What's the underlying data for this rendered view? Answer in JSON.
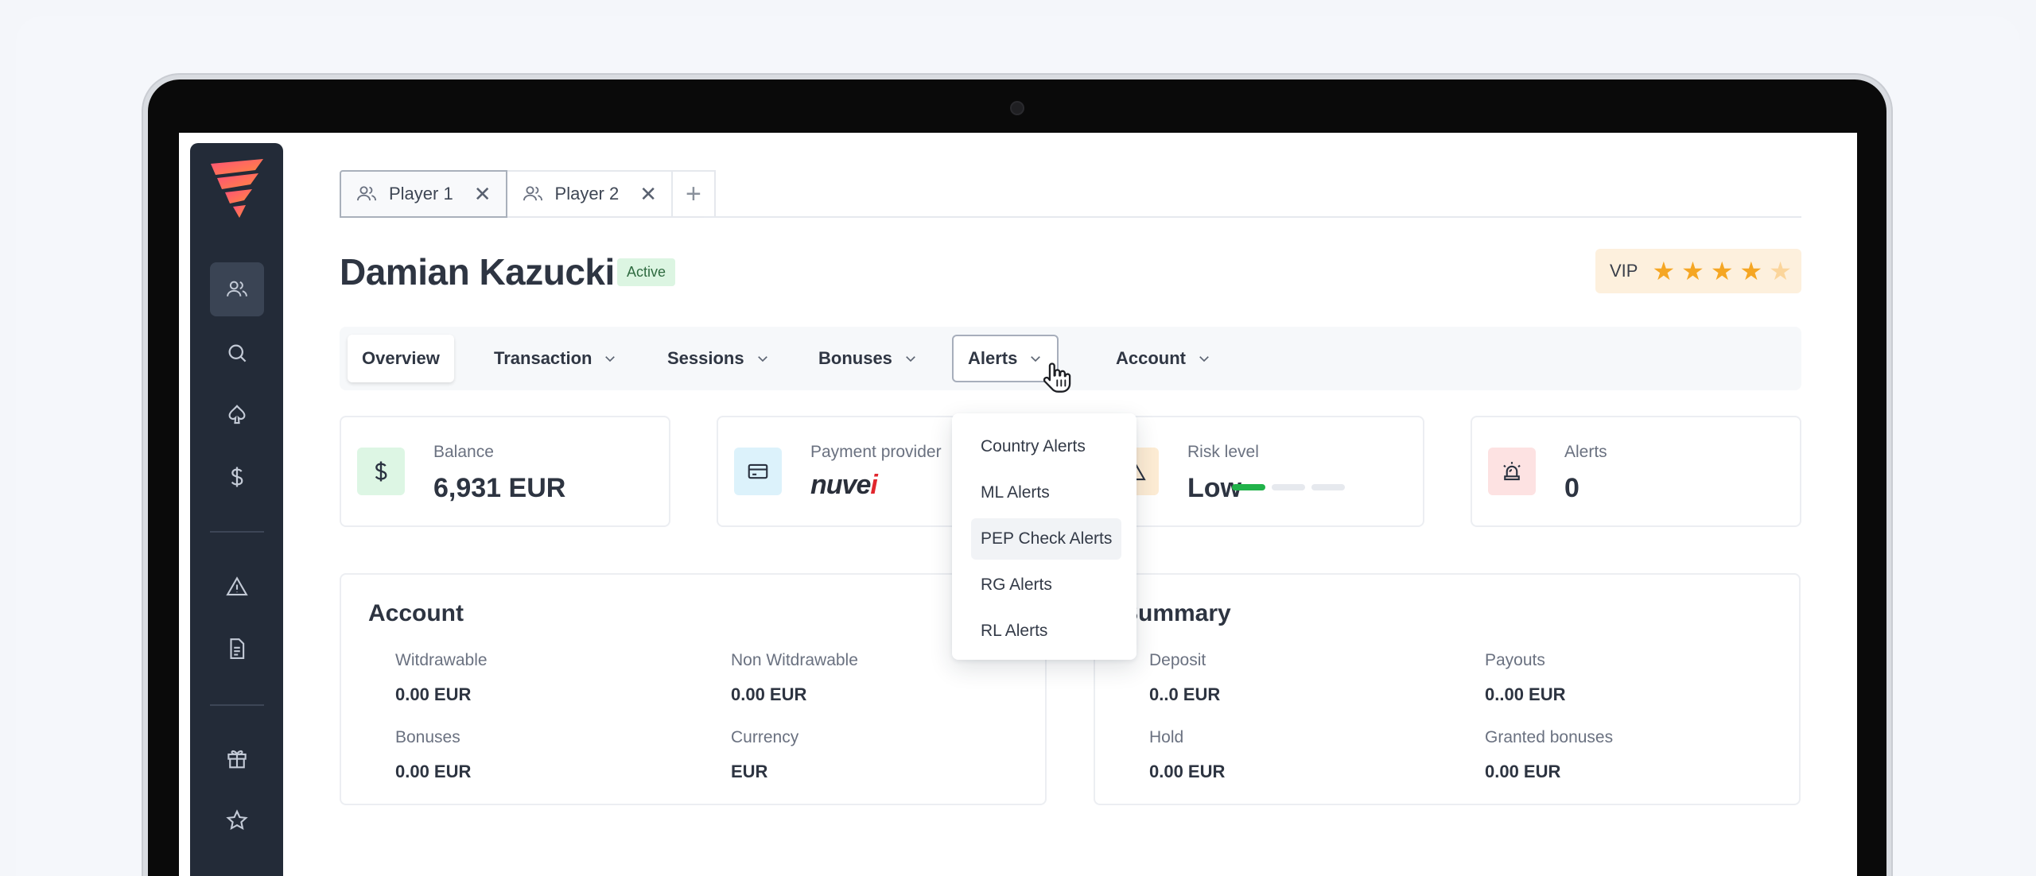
{
  "tabs": [
    {
      "label": "Player 1",
      "icon": "users-icon"
    },
    {
      "label": "Player 2",
      "icon": "users-icon"
    }
  ],
  "player": {
    "name": "Damian Kazucki",
    "status": "Active",
    "vip_label": "VIP",
    "vip_stars": {
      "filled": 4,
      "total": 5
    }
  },
  "menu": {
    "overview": "Overview",
    "transaction": "Transaction",
    "sessions": "Sessions",
    "bonuses": "Bonuses",
    "alerts": "Alerts",
    "account": "Account"
  },
  "stats": {
    "balance": {
      "label": "Balance",
      "value": "6,931 EUR"
    },
    "payment": {
      "label": "Payment provider",
      "value": "nuvei"
    },
    "risk": {
      "label": "Risk level",
      "value": "Low",
      "level": 1,
      "levels": 3
    },
    "alerts": {
      "label": "Alerts",
      "value": "0"
    }
  },
  "account_panel": {
    "title": "Account",
    "fields": [
      {
        "label": "Witdrawable",
        "value": "0.00 EUR"
      },
      {
        "label": "Non Witdrawable",
        "value": "0.00 EUR"
      },
      {
        "label": "Bonuses",
        "value": "0.00 EUR"
      },
      {
        "label": "Currency",
        "value": "EUR"
      }
    ]
  },
  "summary_panel": {
    "title": "Summary",
    "fields": [
      {
        "label": "Deposit",
        "value": "0..0 EUR"
      },
      {
        "label": "Payouts",
        "value": "0..00 EUR"
      },
      {
        "label": "Hold",
        "value": "0.00 EUR"
      },
      {
        "label": "Granted bonuses",
        "value": "0.00 EUR"
      }
    ]
  },
  "alerts_dropdown": {
    "items": [
      "Country Alerts",
      "ML Alerts",
      "PEP Check Alerts",
      "RG Alerts",
      "RL Alerts"
    ],
    "hovered": "PEP Check Alerts"
  },
  "colors": {
    "sidebar": "#232b38",
    "accent_green": "#21b24a",
    "vip_bg": "#fdf0dd",
    "star": "#f5a623",
    "nuvei_red": "#e1262d"
  }
}
